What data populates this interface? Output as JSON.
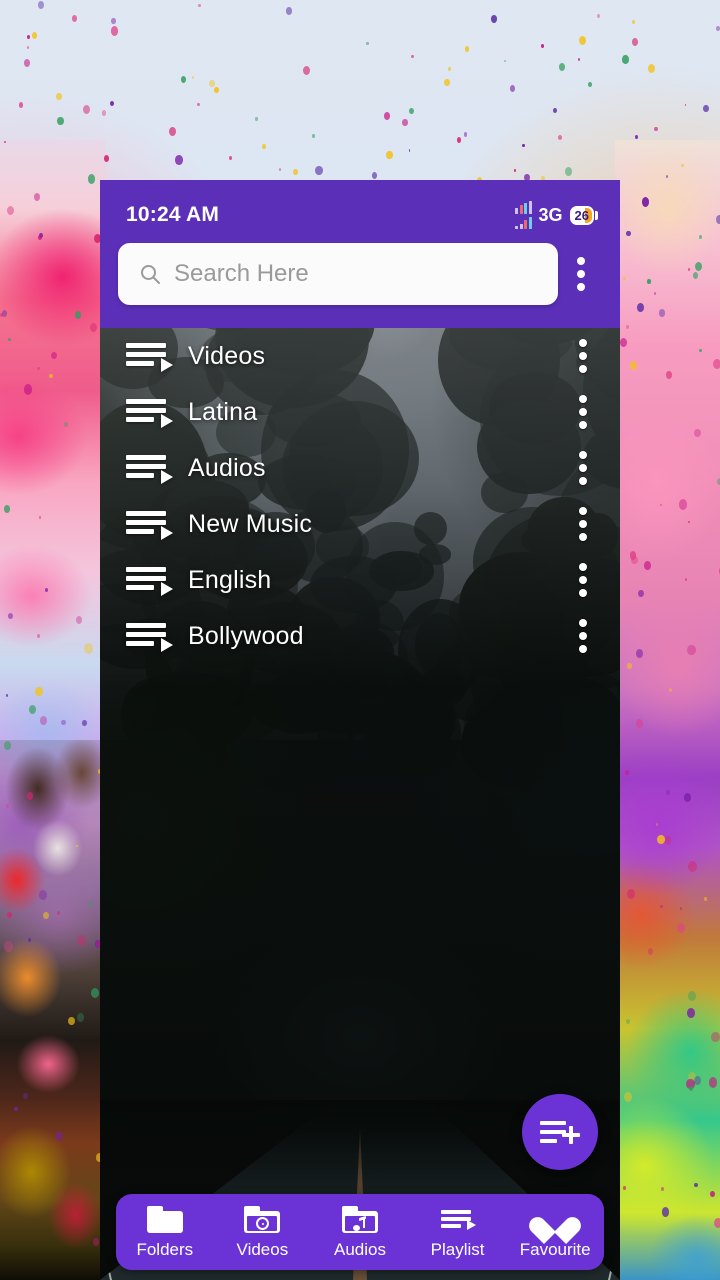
{
  "statusbar": {
    "time": "10:24 AM",
    "network": "3G",
    "battery_level": "26",
    "signal_icon": "signal-bars-icon",
    "battery_icon": "battery-icon"
  },
  "header": {
    "background_color": "#5B2FB8",
    "search": {
      "placeholder": "Search Here",
      "value": "",
      "icon": "search-icon"
    },
    "overflow_menu": {
      "icon": "kebab-menu-icon",
      "label": "More options"
    }
  },
  "playlist": {
    "items": [
      {
        "label": "Videos",
        "icon": "playlist-play-icon",
        "menu_icon": "kebab-menu-icon"
      },
      {
        "label": "Latina",
        "icon": "playlist-play-icon",
        "menu_icon": "kebab-menu-icon"
      },
      {
        "label": "Audios",
        "icon": "playlist-play-icon",
        "menu_icon": "kebab-menu-icon"
      },
      {
        "label": "New Music",
        "icon": "playlist-play-icon",
        "menu_icon": "kebab-menu-icon"
      },
      {
        "label": "English",
        "icon": "playlist-play-icon",
        "menu_icon": "kebab-menu-icon"
      },
      {
        "label": "Bollywood",
        "icon": "playlist-play-icon",
        "menu_icon": "kebab-menu-icon"
      }
    ]
  },
  "fab": {
    "icon": "playlist-add-icon",
    "label": "Add playlist",
    "color": "#6B33D6"
  },
  "bottom_nav": {
    "background_color": "#6B33D6",
    "items": [
      {
        "label": "Folders",
        "icon": "folder-icon"
      },
      {
        "label": "Videos",
        "icon": "folder-video-icon"
      },
      {
        "label": "Audios",
        "icon": "folder-audio-icon"
      },
      {
        "label": "Playlist",
        "icon": "playlist-play-icon"
      },
      {
        "label": "Favourite",
        "icon": "heart-icon"
      }
    ]
  }
}
